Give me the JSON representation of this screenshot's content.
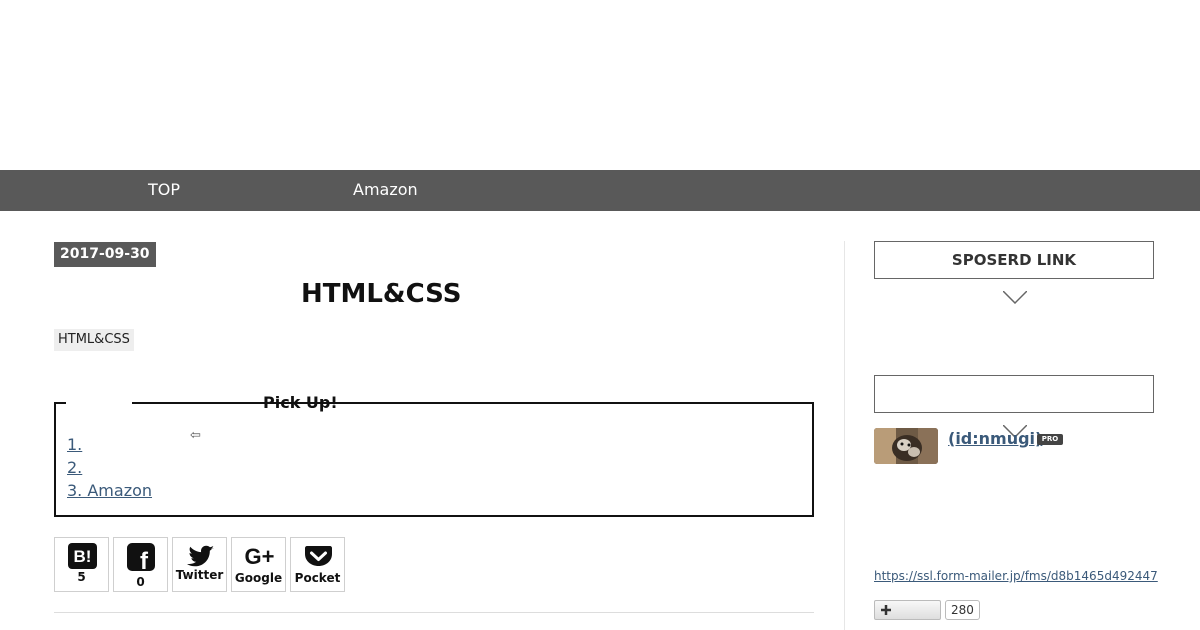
{
  "nav": {
    "items": [
      {
        "label": "TOP"
      },
      {
        "label": "Amazon"
      }
    ]
  },
  "entry": {
    "date": "2017-09-30",
    "title": "HTML&CSS",
    "category": "HTML&CSS"
  },
  "pickup": {
    "label": "Pick Up!",
    "items": [
      "1.",
      "2.",
      "3. Amazon"
    ],
    "arrow": "⇦"
  },
  "share": {
    "buttons": [
      {
        "icon": "hatena-bookmark-icon",
        "icon_text": "B!",
        "label": "5"
      },
      {
        "icon": "facebook-icon",
        "icon_text": "f",
        "label": "0"
      },
      {
        "icon": "twitter-icon",
        "label": "Twitter"
      },
      {
        "icon": "google-plus-icon",
        "icon_text": "G+",
        "label": "Google"
      },
      {
        "icon": "pocket-icon",
        "label": "Pocket"
      }
    ]
  },
  "sidebar": {
    "sponsored_heading": "SPOSERD LINK",
    "second_heading": "",
    "profile": {
      "name": " (id:nmugi)",
      "badge": "PRO"
    },
    "form_link": "https://ssl.form-mailer.jp/fms/d8b1465d492447",
    "follow": {
      "icon": "plus-icon",
      "count": "280"
    }
  },
  "colors": {
    "nav_bg": "#595959",
    "link": "#3b5a7a",
    "badge_bg": "#595959"
  }
}
